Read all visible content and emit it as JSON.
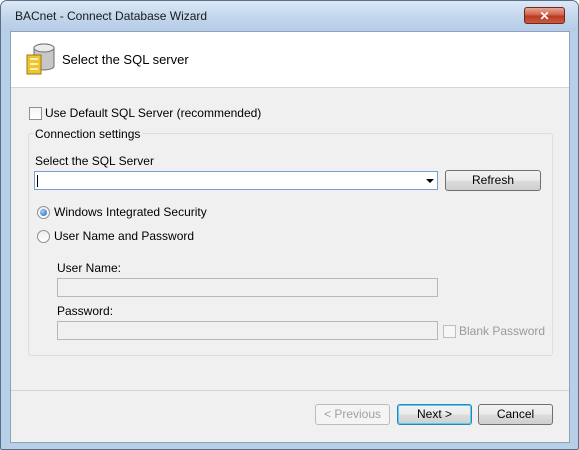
{
  "window": {
    "title": "BACnet - Connect Database Wizard",
    "close_glyph": "✕"
  },
  "header": {
    "title": "Select the SQL server",
    "icon": "database-icon"
  },
  "use_default": {
    "label": "Use Default SQL Server (recommended)",
    "checked": false
  },
  "connection": {
    "group_label": "Connection settings",
    "server_label": "Select the SQL Server",
    "server_value": "",
    "refresh_label": "Refresh",
    "auth_windows_label": "Windows Integrated Security",
    "auth_windows_selected": true,
    "auth_user_label": "User Name and Password",
    "username_label": "User Name:",
    "username_value": "",
    "password_label": "Password:",
    "password_value": "",
    "blank_password_label": "Blank Password"
  },
  "footer": {
    "previous_label": "< Previous",
    "next_label": "Next >",
    "cancel_label": "Cancel"
  },
  "colors": {
    "title_bar": "#c2d6ec",
    "close_button": "#c95a3f",
    "accent_focus": "#3c7fb1"
  }
}
